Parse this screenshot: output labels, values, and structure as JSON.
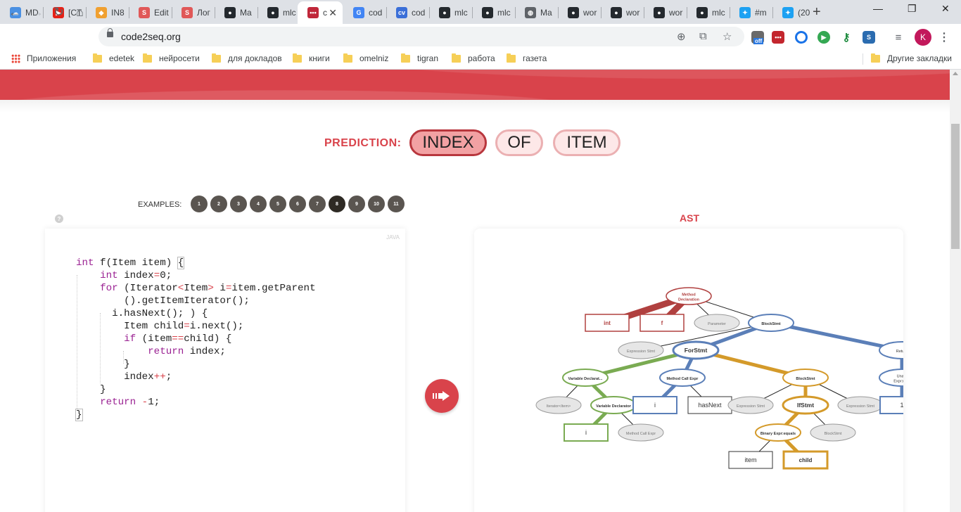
{
  "browser": {
    "tabs": [
      {
        "title": "MD",
        "fav": "cloud-icon",
        "color": "#4a90e2",
        "glyph": "☁"
      },
      {
        "title": "[CT",
        "fav": "youtube-icon",
        "color": "#e62117",
        "glyph": "▶"
      },
      {
        "title": "IN8",
        "fav": "hex-icon",
        "color": "#f0a030",
        "glyph": "◆"
      },
      {
        "title": "Edit",
        "fav": "s-icon",
        "color": "#e05858",
        "glyph": "S"
      },
      {
        "title": "Лог",
        "fav": "s-icon",
        "color": "#e05858",
        "glyph": "S"
      },
      {
        "title": "Ma",
        "fav": "github-icon",
        "color": "#24292e",
        "glyph": "●"
      },
      {
        "title": "mlc",
        "fav": "github-icon",
        "color": "#24292e",
        "glyph": "●"
      },
      {
        "title": "c",
        "fav": "code2seq-icon",
        "color": "#c0273a",
        "glyph": "•••"
      },
      {
        "title": "cod",
        "fav": "google-icon",
        "color": "#4285f4",
        "glyph": "G"
      },
      {
        "title": "cod",
        "fav": "cv-icon",
        "color": "#3b6fd8",
        "glyph": "cv"
      },
      {
        "title": "mlc",
        "fav": "github-icon",
        "color": "#24292e",
        "glyph": "●"
      },
      {
        "title": "mlc",
        "fav": "github-icon",
        "color": "#24292e",
        "glyph": "●"
      },
      {
        "title": "Ma",
        "fav": "globe-icon",
        "color": "#5f6368",
        "glyph": "◍"
      },
      {
        "title": "wor",
        "fav": "github-icon",
        "color": "#24292e",
        "glyph": "●"
      },
      {
        "title": "wor",
        "fav": "github-icon",
        "color": "#24292e",
        "glyph": "●"
      },
      {
        "title": "wor",
        "fav": "github-icon",
        "color": "#24292e",
        "glyph": "●"
      },
      {
        "title": "mlc",
        "fav": "github-icon",
        "color": "#24292e",
        "glyph": "●"
      },
      {
        "title": "#m",
        "fav": "twitter-icon",
        "color": "#1da1f2",
        "glyph": "✦"
      },
      {
        "title": "(20",
        "fav": "twitter-icon",
        "color": "#1da1f2",
        "glyph": "✦"
      }
    ],
    "new_tab": "+",
    "minimize": "—",
    "restore": "❐",
    "close": "✕",
    "url": "code2seq.org",
    "avatar_letter": "K",
    "ext_off_badge": "off",
    "bookmarks": {
      "apps": "Приложения",
      "items": [
        "edetek",
        "нейросети",
        "для докладов",
        "книги",
        "omelniz",
        "tigran",
        "работа",
        "газета"
      ],
      "other": "Другие закладки"
    }
  },
  "page": {
    "prediction_label": "PREDICTION:",
    "prediction_tokens": [
      "INDEX",
      "OF",
      "ITEM"
    ],
    "examples_label": "EXAMPLES:",
    "examples": [
      "1",
      "2",
      "3",
      "4",
      "5",
      "6",
      "7",
      "8",
      "9",
      "10",
      "11"
    ],
    "active_example": "8",
    "help": "?",
    "language": "JAVA",
    "ast_title": "AST",
    "accent": "#d9434b"
  },
  "ast": {
    "nodes": {
      "method_decl": "Method Declaration",
      "int": "int",
      "f": "f",
      "parameter": "Parameter",
      "block_stmt_top": "BlockStmt",
      "expression_stmt_1": "Expression Stmt",
      "for_stmt": "ForStmt",
      "return": "Return",
      "variable_declaration": "Variable Declarat...",
      "method_call_expr": "Method Call Expr",
      "block_stmt_for": "BlockStmt",
      "unary_expr": "Una... Expr:ne...",
      "iterator_item": "Iterator<Item>",
      "variable_declarator": "Variable Declarator",
      "i_box": "i",
      "has_next": "hasNext",
      "expression_stmt_2": "Expression Stmt",
      "if_stmt": "IfStmt",
      "expression_stmt_3": "Expression Stmt",
      "one": "1",
      "i_leaf": "i",
      "method_call_expr_2": "Method Call Expr",
      "binary_expr": "Binary Expr:equals",
      "block_stmt_if": "BlockStmt",
      "item": "item",
      "child": "child"
    },
    "colors": {
      "red": "#b0403f",
      "blue": "#5b7fb8",
      "green": "#7aab52",
      "gold": "#d49a2a",
      "gray_fill": "#e6e6e6",
      "gray_stroke": "#9a9a9a"
    }
  }
}
